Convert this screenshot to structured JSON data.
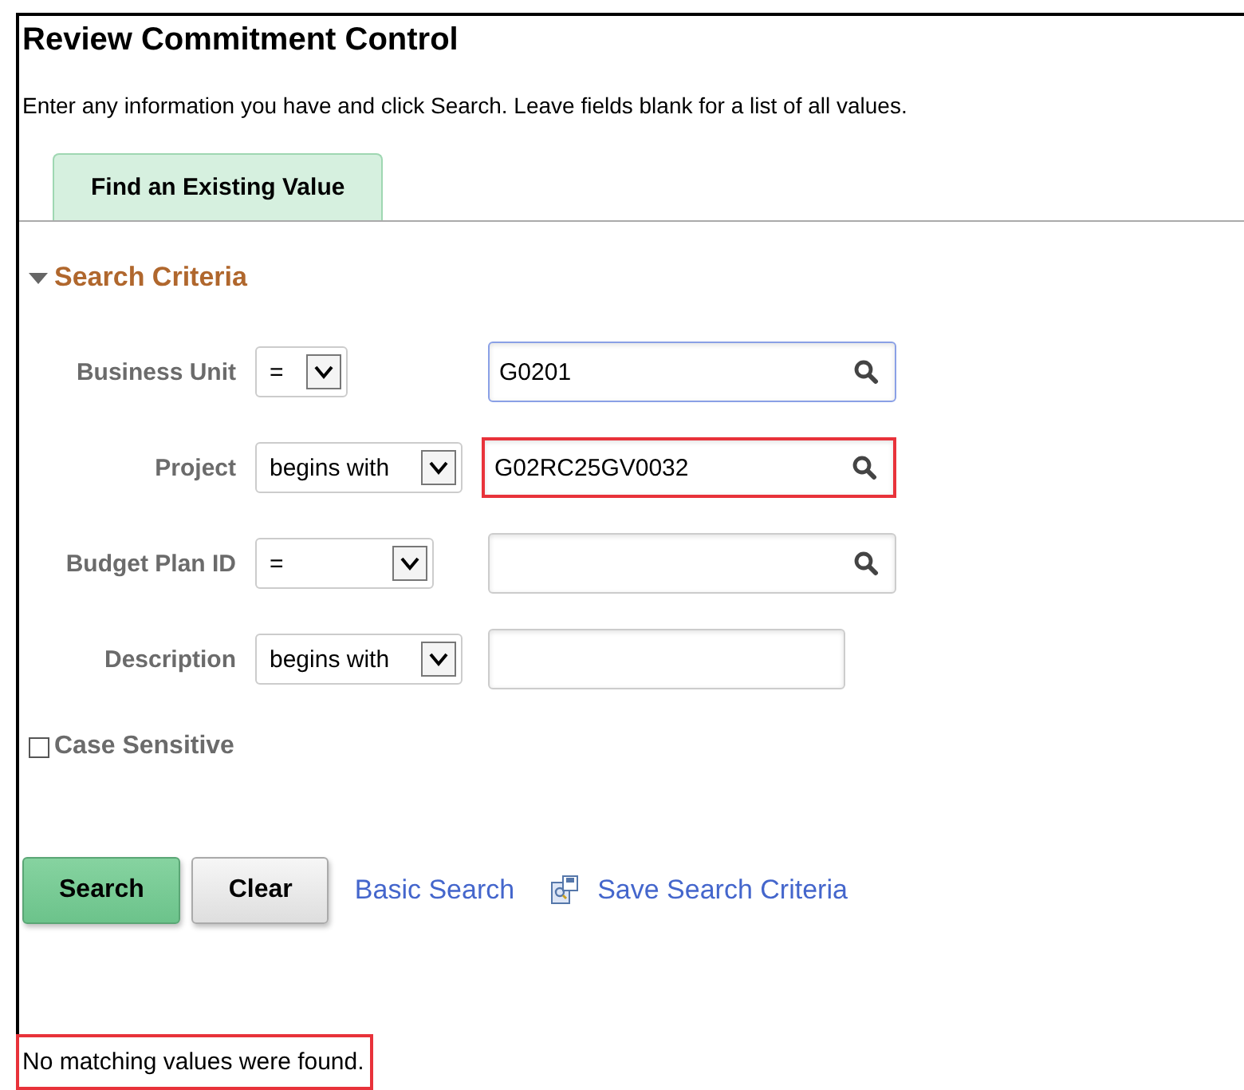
{
  "page": {
    "title": "Review Commitment Control",
    "instructions": "Enter any information you have and click Search. Leave fields blank for a list of all values."
  },
  "tabs": [
    {
      "label": "Find an Existing Value",
      "selected": true
    }
  ],
  "section": {
    "title": "Search Criteria",
    "expanded": true
  },
  "criteria": [
    {
      "label": "Business Unit",
      "operator": "=",
      "value": "G0201",
      "kind": "lookup",
      "focused": true,
      "highlighted": false
    },
    {
      "label": "Project",
      "operator": "begins with",
      "value": "G02RC25GV0032",
      "kind": "lookup",
      "focused": false,
      "highlighted": true
    },
    {
      "label": "Budget Plan ID",
      "operator": "=",
      "kind": "lookup",
      "focused": false,
      "highlighted": false
    },
    {
      "label": "Description",
      "operator": "begins with",
      "kind": "text",
      "focused": false,
      "highlighted": false
    }
  ],
  "case_sensitive": {
    "label": "Case Sensitive",
    "checked": false
  },
  "buttons": [
    {
      "label": "Search",
      "kind": "primary"
    },
    {
      "label": "Clear",
      "kind": "secondary"
    }
  ],
  "links": [
    {
      "label": "Basic Search",
      "kind": "plain"
    },
    {
      "label": "Save Search Criteria",
      "kind": "icon"
    }
  ],
  "message": {
    "text": "No matching values were found.",
    "highlighted": true
  }
}
